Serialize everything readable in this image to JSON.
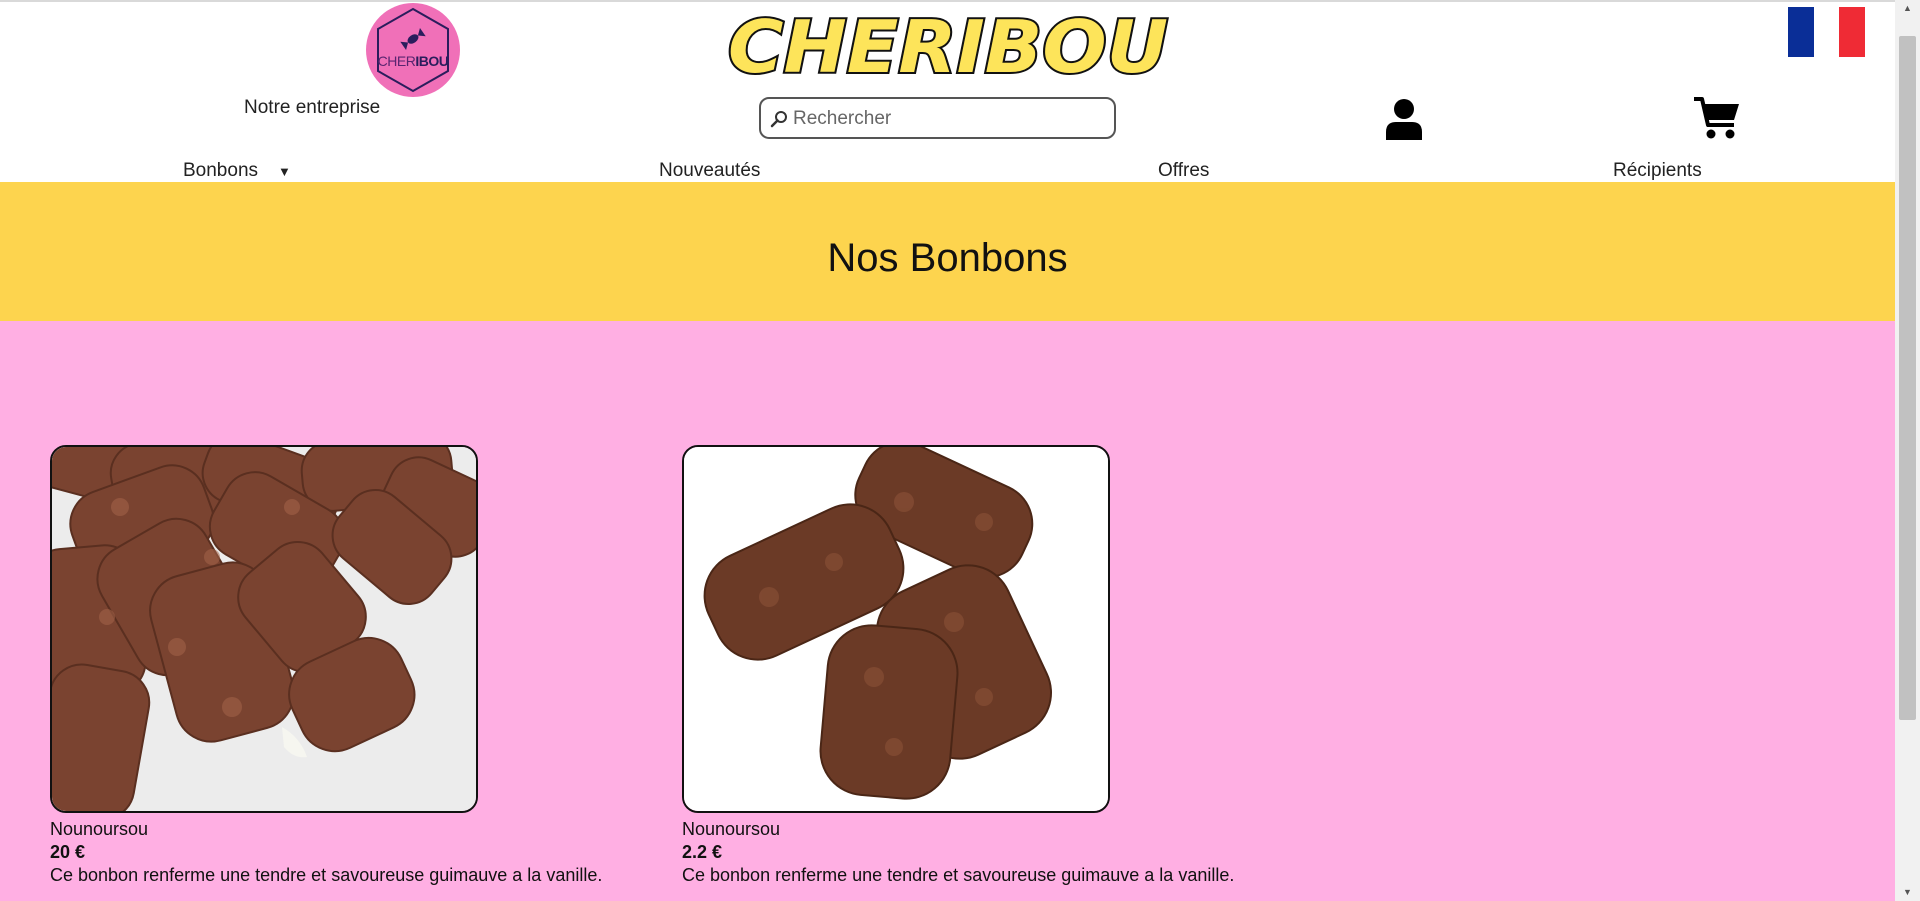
{
  "header": {
    "logo_badge": {
      "text_part1": "CHER",
      "text_part2": "IBOU",
      "icon": "candy-icon"
    },
    "company_link": "Notre entreprise",
    "brand_name": "CHERIBOU",
    "search": {
      "placeholder": "Rechercher",
      "value": "",
      "icon": "search-icon"
    },
    "account_icon": "user-icon",
    "cart_icon": "cart-icon",
    "language_flag": {
      "name": "France",
      "colors": [
        "#0a2e97",
        "#ffffff",
        "#ef2b35"
      ]
    }
  },
  "nav": {
    "items": [
      {
        "label": "Bonbons",
        "has_dropdown": true
      },
      {
        "label": "Nouveautés"
      },
      {
        "label": "Offres"
      },
      {
        "label": "Récipients"
      }
    ]
  },
  "banner": {
    "title": "Nos Bonbons"
  },
  "products": [
    {
      "name": "Nounoursou",
      "price": "20 €",
      "description": "Ce bonbon renferme une tendre et savoureuse guimauve a la vanille."
    },
    {
      "name": "Nounoursou",
      "price": "2.2 €",
      "description": "Ce bonbon renferme une tendre et savoureuse guimauve a la vanille."
    }
  ],
  "colors": {
    "banner_yellow": "#fdd44e",
    "page_pink": "#ffafe3",
    "logo_pink": "#f070b8",
    "brand_yellow": "#fde45a"
  }
}
